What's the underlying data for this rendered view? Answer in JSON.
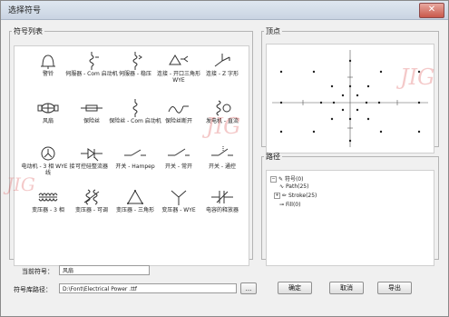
{
  "window": {
    "title": "选择符号",
    "close_glyph": "✕"
  },
  "symbol_list": {
    "legend": "符号列表",
    "items": [
      {
        "label": "警铃",
        "icon": "bell-icon"
      },
      {
        "label": "伺服器 - Com 启动机",
        "icon": "servo-icon"
      },
      {
        "label": "伺服器 - 稳压",
        "icon": "servo-regulator-icon"
      },
      {
        "label": "连接 - 开口三角形 WYE",
        "icon": "delta-wye-icon"
      },
      {
        "label": "连接 - Z 字形",
        "icon": "zigzag-icon"
      },
      {
        "label": "风扇",
        "icon": "fan-icon"
      },
      {
        "label": "保险丝",
        "icon": "fuse-icon"
      },
      {
        "label": "保险丝 - Com 启动机",
        "icon": "fuse-starter-icon"
      },
      {
        "label": "保险丝断开",
        "icon": "fuse-disconnect-icon"
      },
      {
        "label": "发电机 - 直流",
        "icon": "generator-dc-icon"
      },
      {
        "label": "电动机 - 3 相 WYE 接线",
        "icon": "motor-wye-icon"
      },
      {
        "label": "可控硅整流器",
        "icon": "scr-icon"
      },
      {
        "label": "开关 - Hampep",
        "icon": "switch-hampep-icon"
      },
      {
        "label": "开关 - 常开",
        "icon": "switch-open-icon"
      },
      {
        "label": "开关 - 通控",
        "icon": "switch-control-icon"
      },
      {
        "label": "变压器 - 3 相",
        "icon": "transformer-3phase-icon"
      },
      {
        "label": "变压器 - 可调",
        "icon": "transformer-adjustable-icon"
      },
      {
        "label": "变压器 - 三角形",
        "icon": "transformer-delta-icon"
      },
      {
        "label": "变压器 - WYE",
        "icon": "transformer-wye-icon"
      },
      {
        "label": "电容的释放器",
        "icon": "capacitor-icon"
      }
    ]
  },
  "preview": {
    "legend": "顶点"
  },
  "path": {
    "legend": "路径",
    "nodes": [
      {
        "text": "符号(0)",
        "icon": "symbol-icon"
      },
      {
        "text": "Path(25)",
        "icon": "path-icon"
      },
      {
        "text": "Stroke(25)",
        "icon": "stroke-icon"
      },
      {
        "text": "Fill(0)",
        "icon": "fill-icon"
      }
    ]
  },
  "current_symbol": {
    "label": "当前符号：",
    "value": "风扇"
  },
  "library_path": {
    "label": "符号库路径：",
    "value": "D:\\Font\\Electrical Power .ttf",
    "browse_label": "..."
  },
  "buttons": {
    "ok": "确定",
    "cancel": "取消",
    "export": "导出"
  },
  "watermark": "JIG"
}
